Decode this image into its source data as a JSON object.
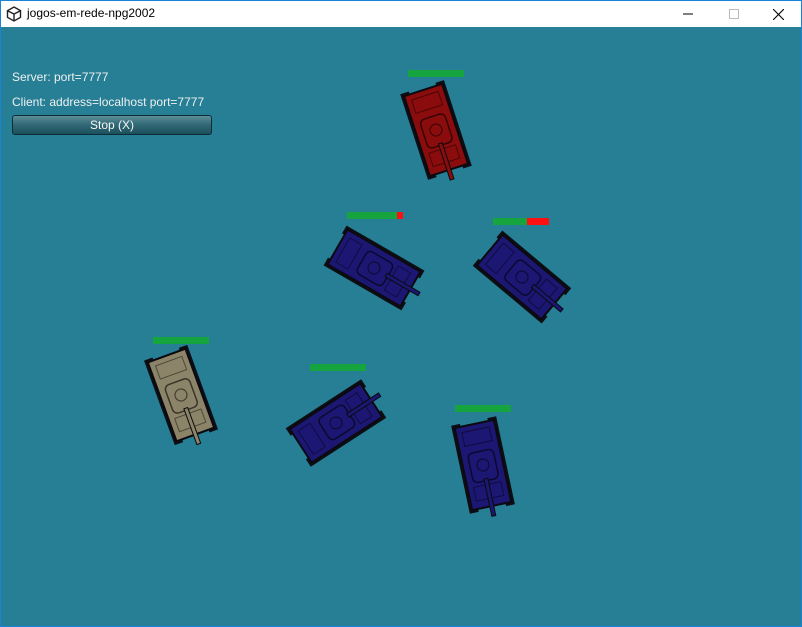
{
  "window": {
    "title": "jogos-em-rede-npg2002",
    "icon": "unity-icon",
    "controls": [
      "minimize-icon",
      "maximize-icon",
      "close-icon"
    ]
  },
  "hud": {
    "server_text": "Server: port=7777",
    "client_text": "Client: address=localhost port=7777",
    "stop_label": "Stop (X)"
  },
  "colors": {
    "background": "#267f95",
    "health": "#15a43d",
    "damage": "#ff1010",
    "tank_red": "#8a0c0c",
    "tank_blue": "#1c1773",
    "tank_player": "#8c8468"
  },
  "tanks": [
    {
      "name": "red-tank",
      "team": "red",
      "health": 1.0
    },
    {
      "name": "blue-tank-1",
      "team": "blue",
      "health": 0.9
    },
    {
      "name": "blue-tank-2",
      "team": "blue",
      "health": 0.6
    },
    {
      "name": "player-tank",
      "team": "player",
      "health": 1.0
    },
    {
      "name": "blue-tank-3",
      "team": "blue",
      "health": 1.0
    },
    {
      "name": "blue-tank-4",
      "team": "blue",
      "health": 1.0
    }
  ]
}
